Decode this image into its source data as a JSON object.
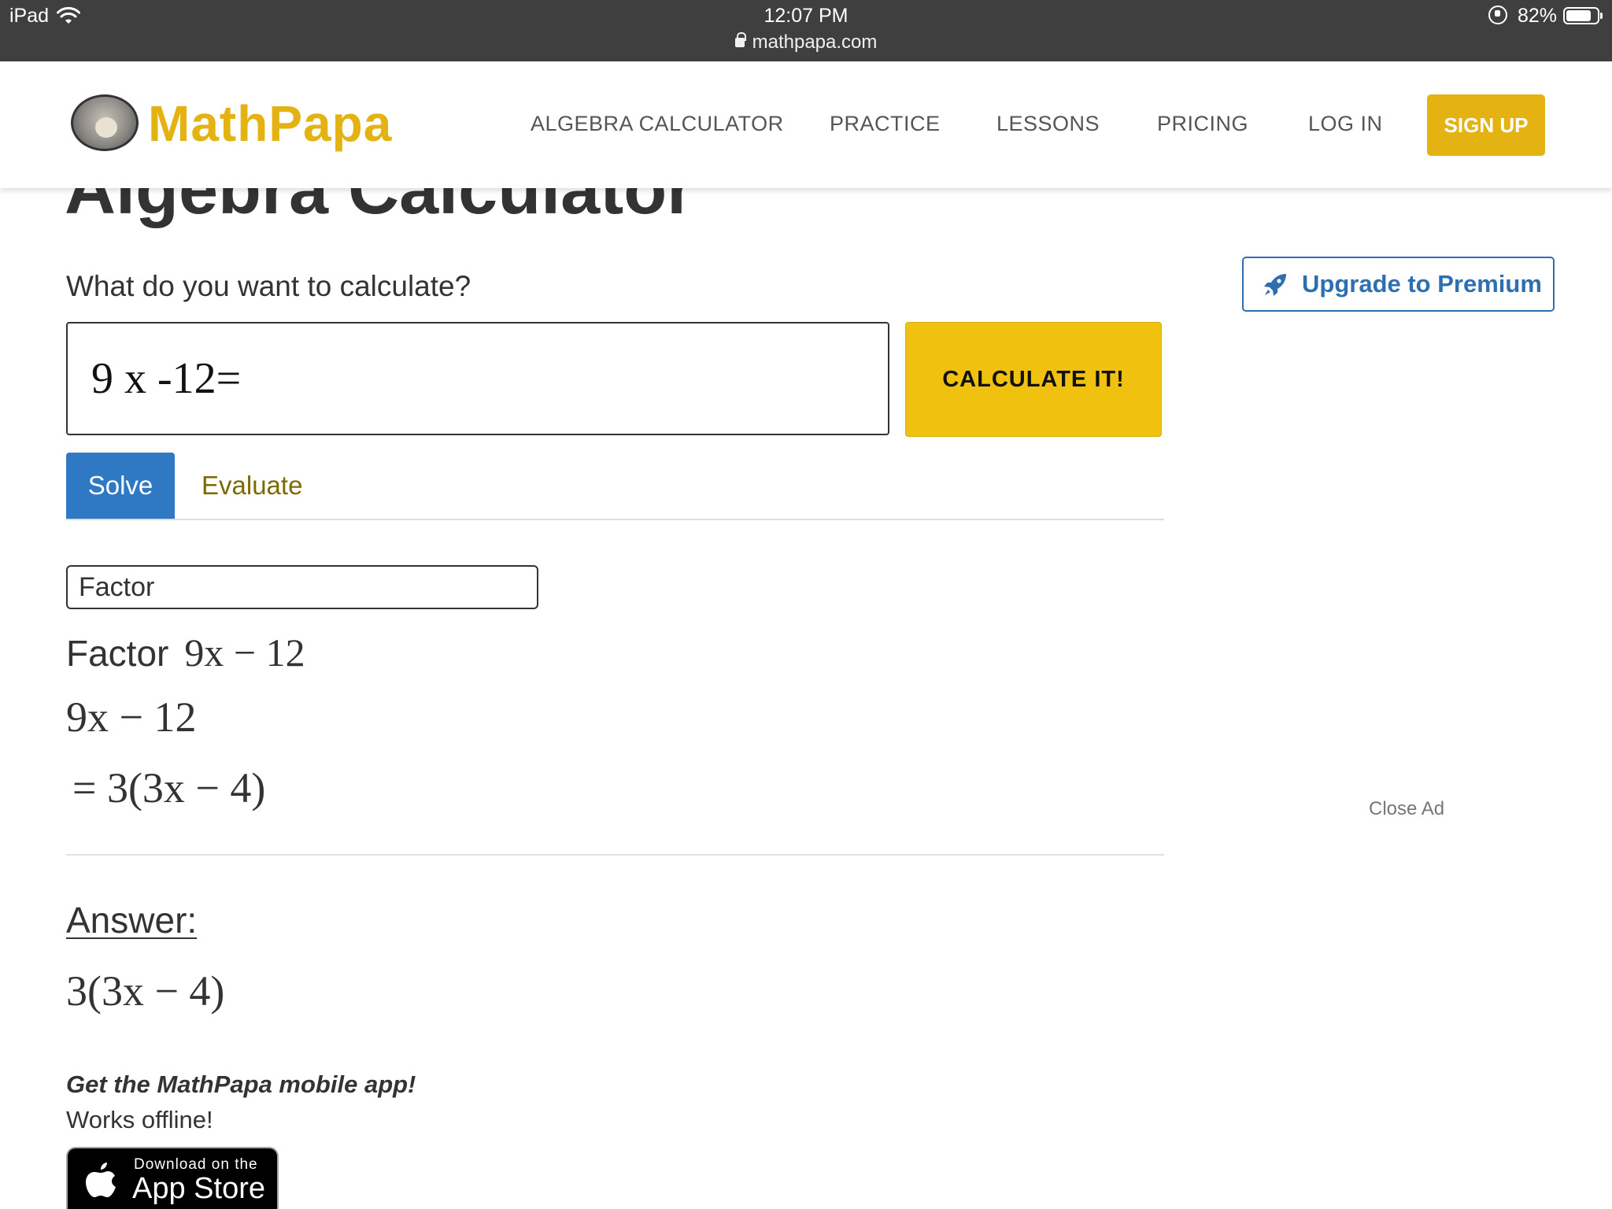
{
  "status_bar": {
    "device": "iPad",
    "time": "12:07 PM",
    "url": "mathpapa.com",
    "battery_pct": "82%",
    "battery_level": 0.82,
    "icons": [
      "wifi-icon",
      "lock-icon",
      "orientation-lock-icon",
      "battery-icon"
    ]
  },
  "header": {
    "logo_text": "MathPapa",
    "nav": [
      {
        "label": "ALGEBRA CALCULATOR"
      },
      {
        "label": "PRACTICE"
      },
      {
        "label": "LESSONS"
      },
      {
        "label": "PRICING"
      },
      {
        "label": "LOG IN"
      }
    ],
    "signup_label": "SIGN UP",
    "brand_color": "#e4b312"
  },
  "main": {
    "title": "Algebra Calculator",
    "prompt": "What do you want to calculate?",
    "input_value": "9 x -12=",
    "calculate_label": "CALCULATE IT!",
    "tabs": [
      {
        "label": "Solve",
        "active": true
      },
      {
        "label": "Evaluate",
        "active": false
      }
    ],
    "method_select": "Factor",
    "step_title_label": "Factor",
    "step_title_expr": "9x − 12",
    "step_expr": "9x − 12",
    "step_result": "= 3(3x − 4)",
    "answer_label": "Answer:",
    "answer_value": "3(3x − 4)",
    "app_promo_title": "Get the MathPapa mobile app!",
    "app_promo_sub": "Works offline!",
    "appstore_small": "Download on the",
    "appstore_big": "App Store"
  },
  "sidebar": {
    "premium_label": "Upgrade to Premium",
    "close_ad_label": "Close Ad"
  },
  "colors": {
    "accent_yellow": "#f0c20f",
    "solve_tab_blue": "#2f78c4",
    "premium_blue": "#2f6fb0",
    "status_bar_bg": "#3f3f3f"
  }
}
